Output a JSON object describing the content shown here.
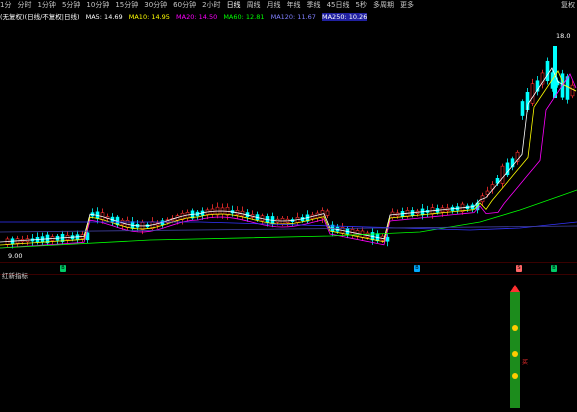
{
  "toolbar": {
    "timeframes": [
      "1分",
      "分时",
      "1分钟",
      "5分钟",
      "10分钟",
      "15分钟",
      "30分钟",
      "60分钟",
      "2小时",
      "日线",
      "周线",
      "月线",
      "年线",
      "季线",
      "45日线",
      "5秒",
      "多周期",
      "更多"
    ],
    "active_index": 9,
    "right_label": "复权"
  },
  "ma_bar": {
    "formula": "(无复权)(日线/不复权|日线)",
    "ma5": "MA5: 14.69",
    "ma10": "MA10: 14.95",
    "ma20": "MA20: 14.50",
    "ma60": "MA60: 12.81",
    "ma120": "MA120: 11.67",
    "ma250": "MA250: 10.26"
  },
  "colors": {
    "ma5": "#ffffff",
    "ma10": "#ffff00",
    "ma20": "#ff00ff",
    "ma60": "#00ff00",
    "ma120": "#3333ff",
    "ma250": "#4040a0",
    "up": "#ff3030",
    "down": "#00ffff",
    "indicator": "#1c8c1c"
  },
  "price_labels": {
    "high": "18.0",
    "low": "9.00"
  },
  "sub_panel": {
    "title": "红新指标"
  },
  "signal_badges": [
    "B",
    "B",
    "S",
    "B"
  ],
  "indicator": {
    "marks": [
      "◆",
      "◆",
      "◆"
    ],
    "tag": "买"
  }
}
